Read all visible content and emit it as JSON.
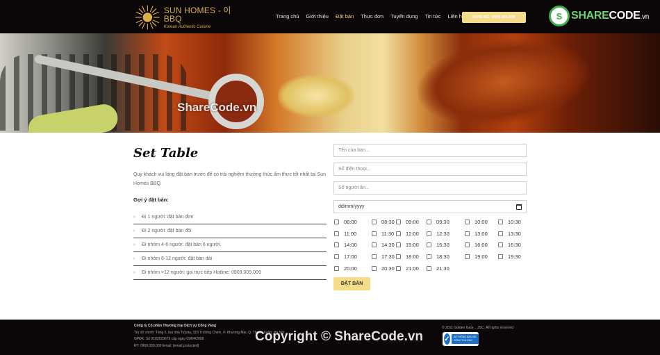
{
  "header": {
    "logo": {
      "name": "SUN HOMES - 이 BBQ",
      "tagline": "Korean Authentic Cuisine"
    },
    "nav": [
      {
        "label": "Trang chủ"
      },
      {
        "label": "Giới thiệu"
      },
      {
        "label": "Đặt bàn",
        "active": true
      },
      {
        "label": "Thực đơn"
      },
      {
        "label": "Tuyển dụng"
      },
      {
        "label": "Tin tức"
      },
      {
        "label": "Liên hệ"
      }
    ],
    "hotline": "HOTLINE: 0909.009.009",
    "sharecode": {
      "text1": "SHARE",
      "text2": "CODE",
      "suffix": ".vn"
    }
  },
  "banner": {
    "watermark": "ShareCode.vn"
  },
  "main": {
    "title": "Set Table",
    "intro": "Quý khách vui lòng đặt bàn trước để có trải nghiệm thưởng thức ẩm thực tốt nhất tại Sun Homes BBQ.",
    "suggest_heading": "Gợi ý đặt bàn:",
    "suggestions": [
      "Đi 1 người: đặt bàn đơn",
      "Đi 2 người: đặt bàn đôi",
      "Đi nhóm 4-6 người: đặt bàn 6 người.",
      "Đi nhóm 6-12 người: đặt bàn dài",
      "Đi nhóm >12 người: gọi trực tiếp Hotline: 0909.009.009"
    ]
  },
  "form": {
    "name_placeholder": "Tên của bạn...",
    "phone_placeholder": "Số điện thoại...",
    "people_placeholder": "Số người ăn...",
    "date_placeholder": "dd/mm/yyyy",
    "times": [
      "08:00",
      "08:30",
      "09:00",
      "09:30",
      "10:00",
      "10:30",
      "11:00",
      "11:30",
      "12:00",
      "12:30",
      "13:00",
      "13:30",
      "14:00",
      "14:30",
      "15:00",
      "15:30",
      "16:00",
      "16:30",
      "17:00",
      "17:30",
      "18:00",
      "18:30",
      "19:00",
      "19:30",
      "20:00",
      "20:30",
      "21:00",
      "21:30"
    ],
    "submit_label": "ĐẶT BÀN"
  },
  "footer": {
    "company": "Công ty Cổ phần Thương mại Dịch vụ Cổng Vàng",
    "address": "Trụ sở chính: Tầng 6, tòa nhà Toyota, 315 Trường Chinh, P. Khương Mai, Q. Thanh Xuân, Hà Nội",
    "license": "GPĐK: Số 0102023679 cấp ngày 09/04/2008",
    "contact": "ĐT: 0909.009.009 Email: [email protected]",
    "copyright": "© 2011 Golden Gate ., JSC. All rights reserved",
    "badge": "ĐÃ THÔNG BÁO BỘ CÔNG THƯƠNG",
    "watermark": "Copyright © ShareCode.vn"
  }
}
